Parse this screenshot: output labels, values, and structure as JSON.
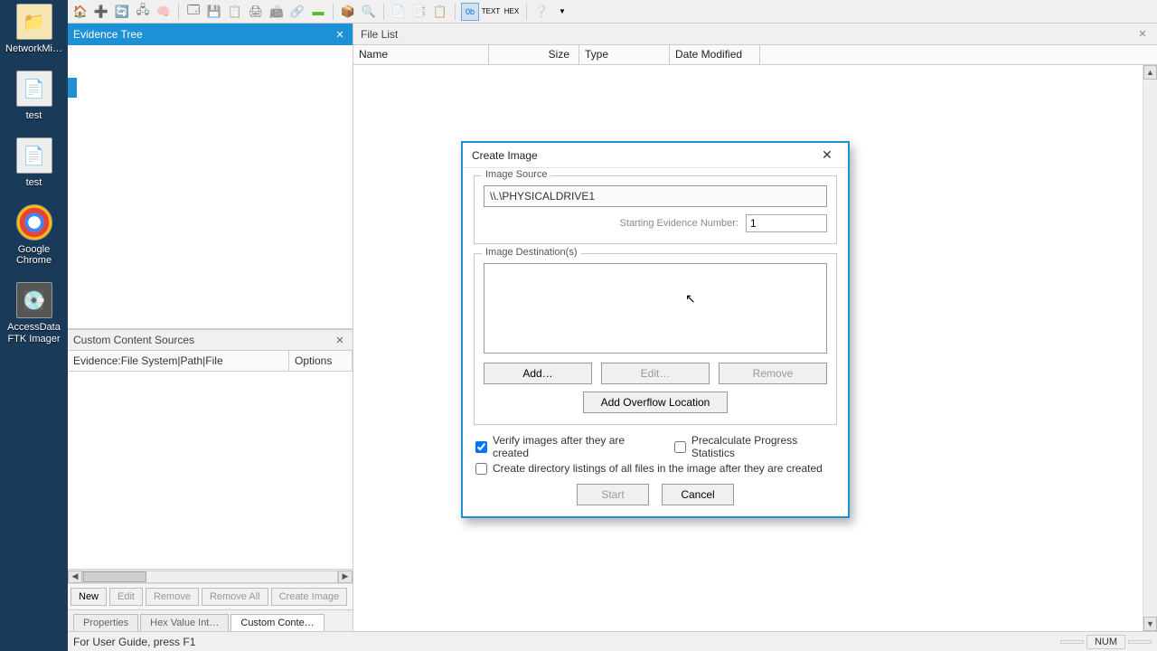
{
  "desktop": {
    "items": [
      {
        "label": "NetworkMi…",
        "icon": "📁"
      },
      {
        "label": "test",
        "icon": "📄"
      },
      {
        "label": "test",
        "icon": "📄"
      },
      {
        "label": "Google Chrome",
        "icon": "🌐"
      },
      {
        "label": "AccessData FTK Imager",
        "icon": "💽"
      }
    ]
  },
  "panes": {
    "evidence_tree": "Evidence Tree",
    "file_list": "File List",
    "custom_sources": "Custom Content Sources",
    "custom_col1": "Evidence:File System|Path|File",
    "custom_col2": "Options"
  },
  "filelist_cols": {
    "name": "Name",
    "size": "Size",
    "type": "Type",
    "date": "Date Modified"
  },
  "custom_buttons": {
    "new": "New",
    "edit": "Edit",
    "remove": "Remove",
    "remove_all": "Remove All",
    "create_image": "Create Image"
  },
  "bottom_tabs": {
    "properties": "Properties",
    "hex": "Hex Value Int…",
    "custom": "Custom Conte…"
  },
  "status": {
    "left": "For User Guide, press F1",
    "num": "NUM"
  },
  "dialog": {
    "title": "Create Image",
    "group_source": "Image Source",
    "source_value": "\\\\.\\PHYSICALDRIVE1",
    "starting_num_label": "Starting Evidence Number:",
    "starting_num_value": "1",
    "group_dest": "Image Destination(s)",
    "btn_add": "Add…",
    "btn_edit": "Edit…",
    "btn_remove": "Remove",
    "btn_overflow": "Add Overflow Location",
    "chk_verify": "Verify images after they are created",
    "chk_precalc": "Precalculate Progress Statistics",
    "chk_dirlist": "Create directory listings of all files in the image after they are created",
    "btn_start": "Start",
    "btn_cancel": "Cancel"
  }
}
